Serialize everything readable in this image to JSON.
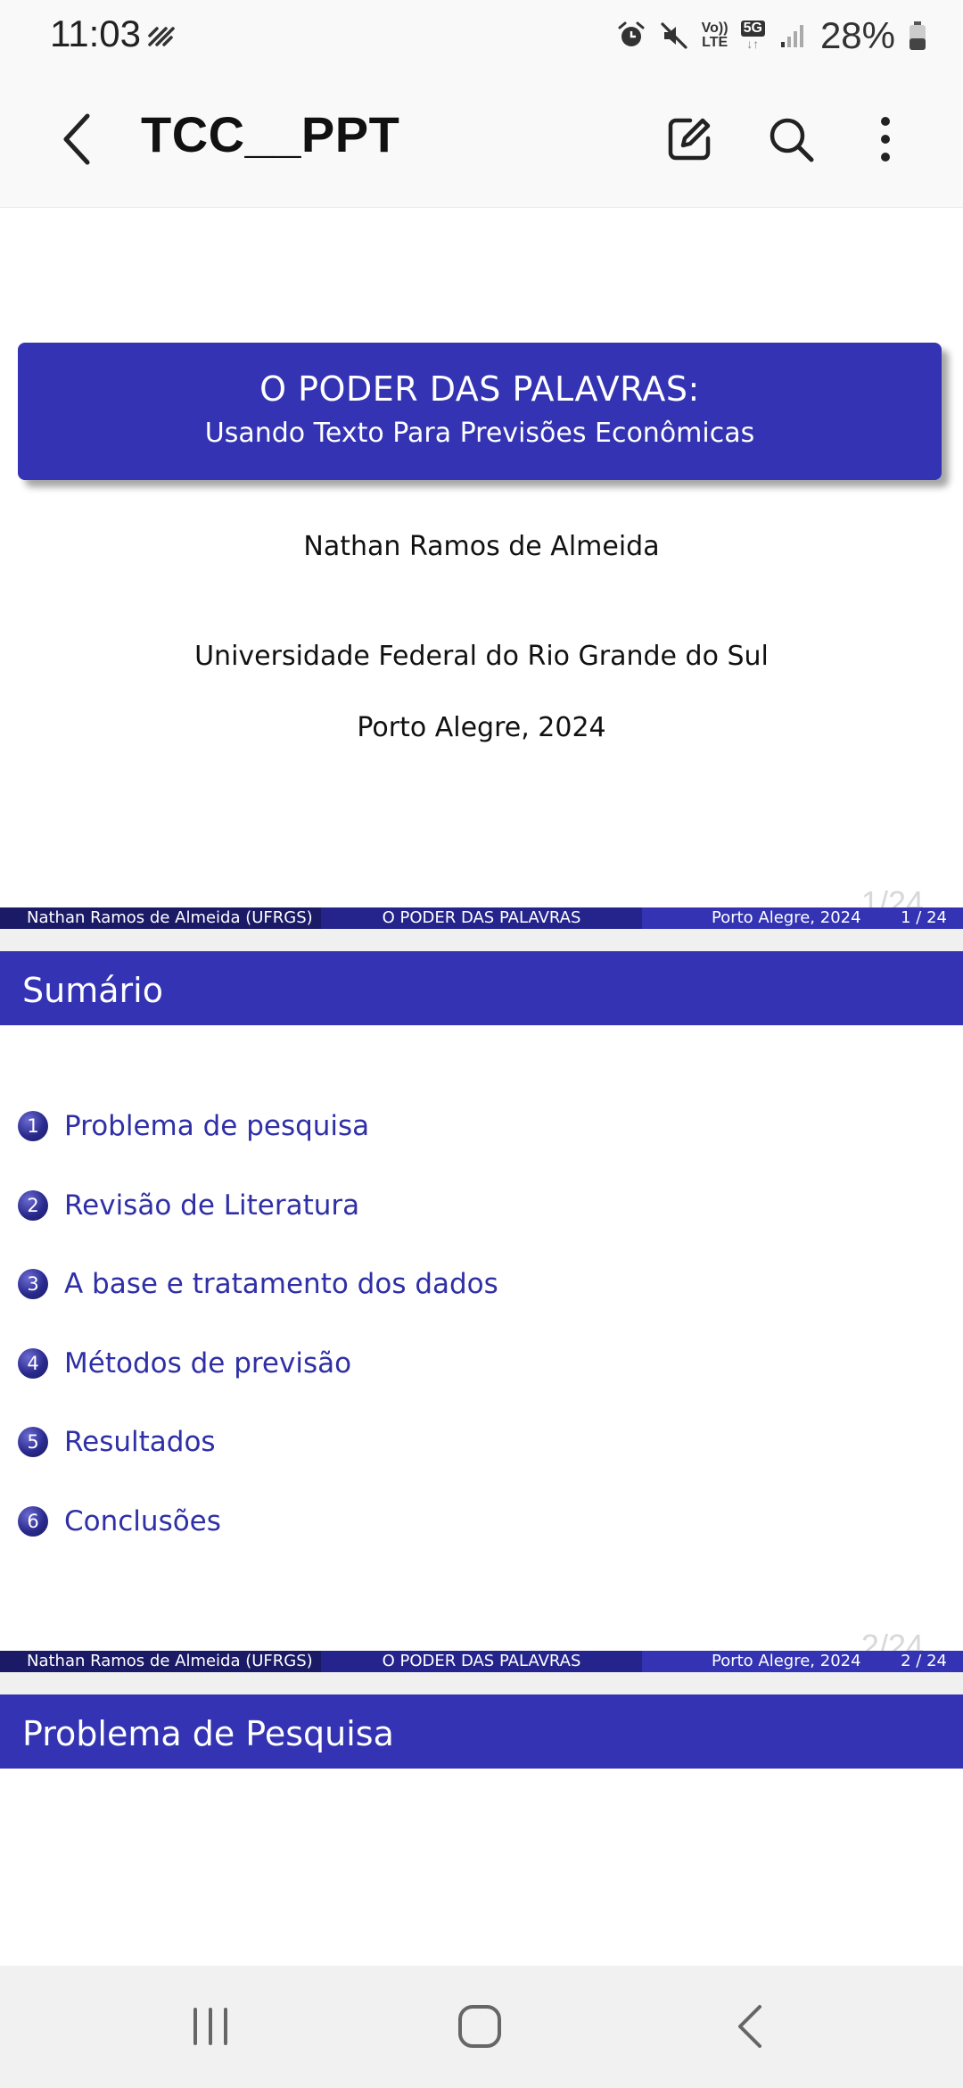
{
  "status_bar": {
    "time": "11:03",
    "net_top": "Vo))",
    "net_bottom": "LTE",
    "net_5g": "5G",
    "battery": "28%"
  },
  "app_bar": {
    "title": "TCC__PPT"
  },
  "slides": [
    {
      "title": "O PODER DAS PALAVRAS:",
      "subtitle": "Usando Texto Para Previsões Econômicas",
      "author": "Nathan Ramos de Almeida",
      "institution": "Universidade Federal do Rio Grande do Sul",
      "place_date": "Porto Alegre, 2024",
      "footer": {
        "author": "Nathan Ramos de Almeida  (UFRGS)",
        "title": "O PODER DAS PALAVRAS",
        "place_date": "Porto Alegre, 2024",
        "page": "1 / 24"
      },
      "ghost_page": "1/24"
    },
    {
      "title": "Sumário",
      "toc": [
        {
          "num": "1",
          "label": "Problema de pesquisa"
        },
        {
          "num": "2",
          "label": "Revisão de Literatura"
        },
        {
          "num": "3",
          "label": "A base e tratamento dos dados"
        },
        {
          "num": "4",
          "label": "Métodos de previsão"
        },
        {
          "num": "5",
          "label": "Resultados"
        },
        {
          "num": "6",
          "label": "Conclusões"
        }
      ],
      "footer": {
        "author": "Nathan Ramos de Almeida  (UFRGS)",
        "title": "O PODER DAS PALAVRAS",
        "place_date": "Porto Alegre, 2024",
        "page": "2 / 24"
      },
      "ghost_page": "2/24"
    },
    {
      "title": "Problema de Pesquisa"
    }
  ],
  "colors": {
    "beamer_blue": "#3333b3",
    "beamer_dark": "#1a1a66",
    "beamer_mid": "#24248c",
    "toc_text": "#2f2fa6"
  },
  "icons": {
    "back": "back-arrow-icon",
    "edit": "edit-icon",
    "search": "search-icon",
    "more": "more-vert-icon",
    "nav_recent": "recent-apps-icon",
    "nav_home": "home-icon",
    "nav_back": "nav-back-icon"
  }
}
